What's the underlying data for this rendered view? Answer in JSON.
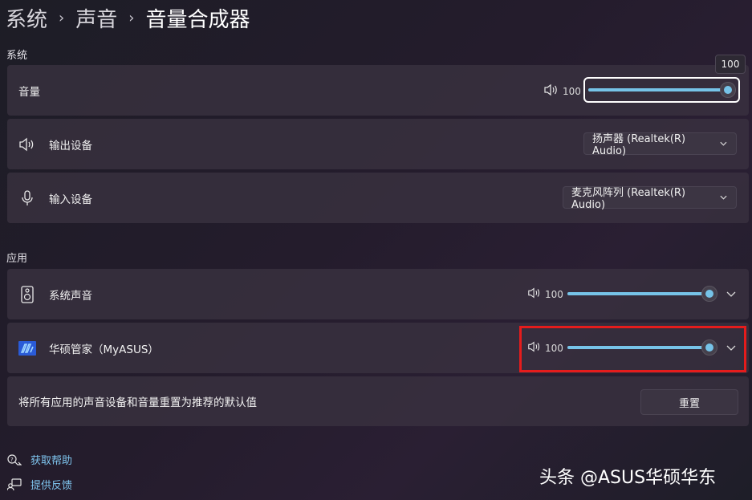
{
  "breadcrumb": {
    "item1": "系统",
    "item2": "声音",
    "current": "音量合成器"
  },
  "system_section": {
    "label": "系统",
    "volume": {
      "label": "音量",
      "value": "100",
      "tooltip": "100",
      "level": 1.0
    },
    "output": {
      "label": "输出设备",
      "selected": "扬声器 (Realtek(R) Audio)"
    },
    "input": {
      "label": "输入设备",
      "selected": "麦克风阵列 (Realtek(R) Audio)"
    }
  },
  "apps_section": {
    "label": "应用",
    "apps": [
      {
        "name": "系统声音",
        "value": "100",
        "level": 1.0,
        "icon": "speaker-box-icon"
      },
      {
        "name": "华硕管家（MyASUS）",
        "value": "100",
        "level": 1.0,
        "icon": "myasus-logo-icon"
      }
    ]
  },
  "reset": {
    "text": "将所有应用的声音设备和音量重置为推荐的默认值",
    "button": "重置"
  },
  "footer": {
    "help": "获取帮助",
    "feedback": "提供反馈"
  },
  "watermark": "头条 @ASUS华硕华东",
  "colors": {
    "accent": "#76c3e8",
    "link": "#7fc5ef",
    "highlight": "#e51c1c"
  }
}
